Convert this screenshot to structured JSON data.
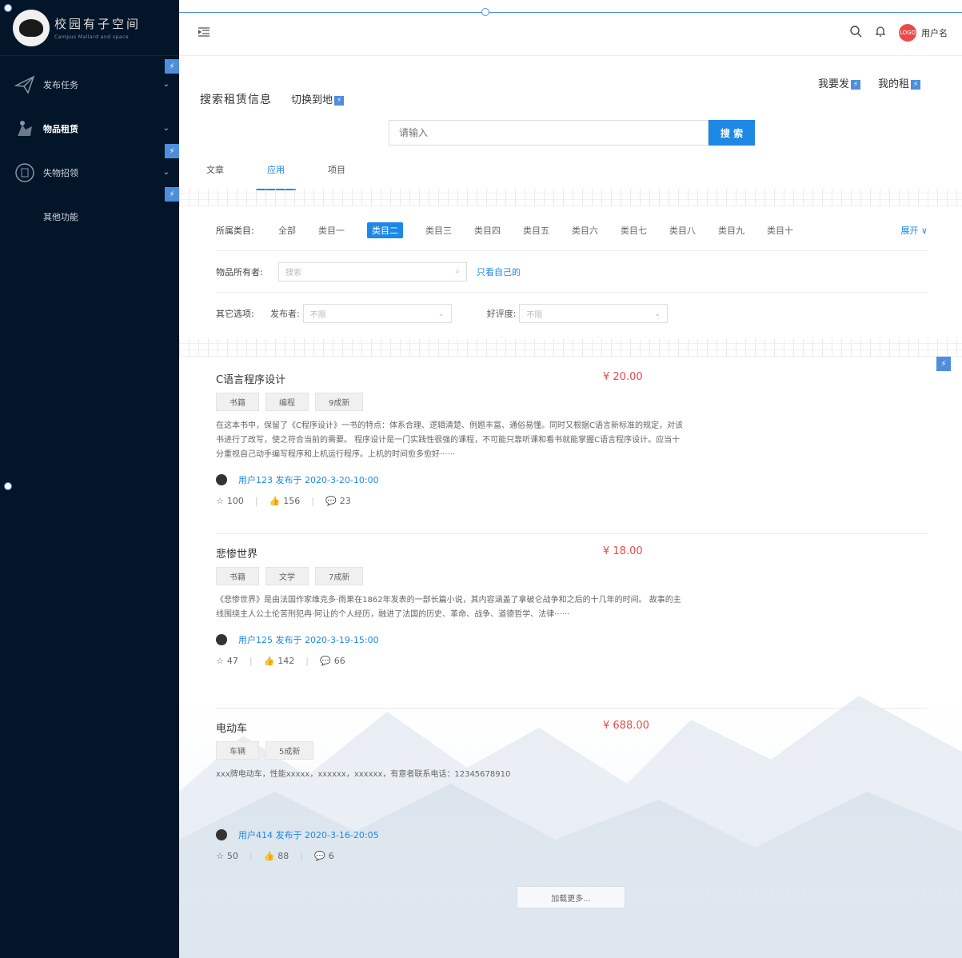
{
  "sidebar": {
    "logo_title": "校园有子空间",
    "logo_sub": "Campus Mallard and space",
    "items": [
      {
        "label": "发布任务",
        "icon": "paper-plane-icon",
        "chevron": "⌄"
      },
      {
        "label": "物品租赁",
        "icon": "rental-icon",
        "chevron": "⌄"
      },
      {
        "label": "失物招领",
        "icon": "lost-found-icon",
        "chevron": "⌄"
      },
      {
        "label": "其他功能",
        "icon": "",
        "chevron": ""
      }
    ],
    "flash": "⚡"
  },
  "header": {
    "username": "用户名",
    "avatar_text": "LOGO"
  },
  "main": {
    "title": "搜索租赁信息",
    "switch_label": "切换到地",
    "links": [
      "我要发",
      "我的租"
    ],
    "search_placeholder": "请输入",
    "search_button": "搜 索",
    "tabs": [
      "文章",
      "应用",
      "项目"
    ],
    "filters": {
      "category_label": "所属类目:",
      "categories": [
        "全部",
        "类目一",
        "类目二",
        "类目三",
        "类目四",
        "类目五",
        "类目六",
        "类目七",
        "类目八",
        "类目九",
        "类目十"
      ],
      "active_category": "类目二",
      "expand": "展开 ∨",
      "owner_label": "物品所有者:",
      "owner_placeholder": "搜索",
      "only_mine": "只看自己的",
      "other_label": "其它选项:",
      "publisher_label": "发布者:",
      "publisher_value": "不限",
      "rating_label": "好评度:",
      "rating_value": "不限"
    },
    "items": [
      {
        "title": "C语言程序设计",
        "price": "¥ 20.00",
        "tags": [
          "书籍",
          "编程",
          "9成新"
        ],
        "desc": "在这本书中，保留了《C程序设计》一书的特点：体系合理、逻辑清楚、例题丰富、通俗易懂。同时又根据C语言新标准的规定，对该书进行了改写，使之符合当前的需要。 程序设计是一门实践性很强的课程，不可能只靠听课和看书就能掌握C语言程序设计。应当十分重视自己动手编写程序和上机运行程序。上机的时间愈多愈好······",
        "meta": "用户123 发布于 2020-3-20-10:00",
        "stars": "100",
        "likes": "156",
        "comments": "23"
      },
      {
        "title": "悲惨世界",
        "price": "¥ 18.00",
        "tags": [
          "书籍",
          "文学",
          "7成新"
        ],
        "desc": "《悲惨世界》是由法国作家维克多·雨果在1862年发表的一部长篇小说，其内容涵盖了拿破仑战争和之后的十几年的时间。 故事的主线围绕主人公土伦苦刑犯冉·阿让的个人经历，融进了法国的历史、革命、战争、道德哲学、法律······",
        "meta": "用户125 发布于 2020-3-19-15:00",
        "stars": "47",
        "likes": "142",
        "comments": "66"
      },
      {
        "title": "电动车",
        "price": "¥ 688.00",
        "tags": [
          "车辆",
          "5成新"
        ],
        "desc": "xxx牌电动车，性能xxxxx，xxxxxx，xxxxxx，有意者联系电话：12345678910",
        "meta": "用户414 发布于 2020-3-16-20:05",
        "stars": "50",
        "likes": "88",
        "comments": "6"
      }
    ],
    "load_more": "加载更多..."
  }
}
